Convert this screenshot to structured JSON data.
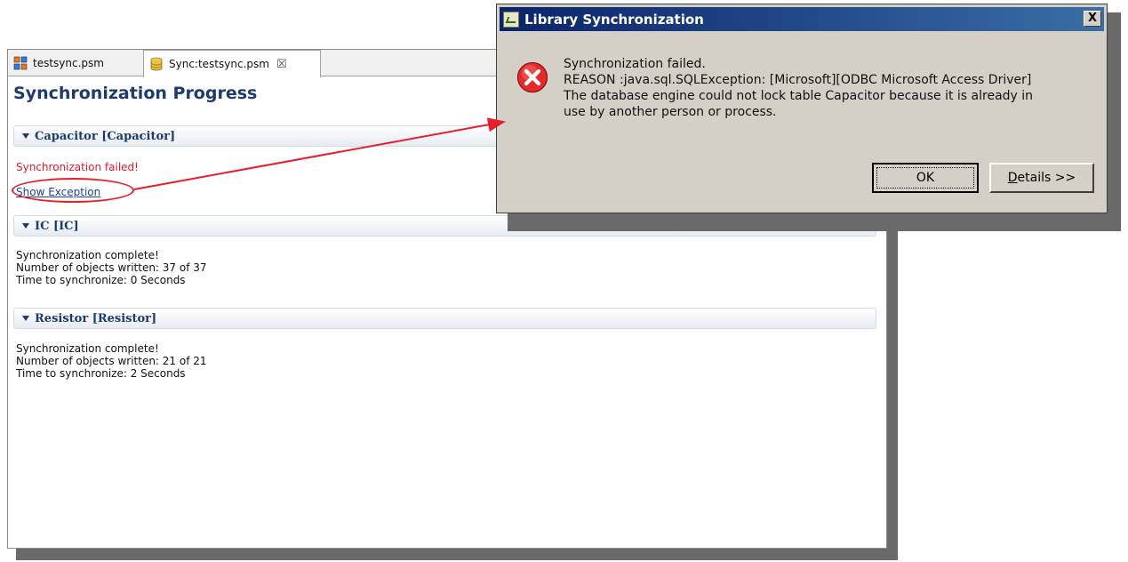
{
  "editor": {
    "tabs": [
      {
        "label": "testsync.psm",
        "active": false
      },
      {
        "label": "Sync:testsync.psm",
        "active": true
      }
    ],
    "close_symbol": "☒",
    "page_title": "Synchronization Progress",
    "sections": [
      {
        "header": "Capacitor [Capacitor]",
        "status": "Synchronization failed!",
        "link": "Show Exception"
      },
      {
        "header": "IC [IC]",
        "lines": [
          "Synchronization complete!",
          "Number of objects written: 37 of 37",
          "Time to synchronize: 0 Seconds"
        ]
      },
      {
        "header": "Resistor [Resistor]",
        "lines": [
          "Synchronization complete!",
          "Number of objects written: 21 of 21",
          "Time to synchronize: 2 Seconds"
        ]
      }
    ]
  },
  "dialog": {
    "title": "Library Synchronization",
    "close_label": "X",
    "icon": "error-icon",
    "message_lines": [
      "Synchronization failed.",
      "REASON :java.sql.SQLException: [Microsoft][ODBC Microsoft Access Driver]",
      "The database engine could not lock table Capacitor because it is already in",
      "use by another person or process."
    ],
    "ok_label": "OK",
    "details_mnemonic": "D",
    "details_rest": "etails >>"
  },
  "colors": {
    "title_blue": "#1d3b6d",
    "error_red": "#e8182c",
    "link_blue": "#1b3fa5",
    "annotation_red": "#e81e2a",
    "dialog_gray": "#d4d0c8"
  }
}
